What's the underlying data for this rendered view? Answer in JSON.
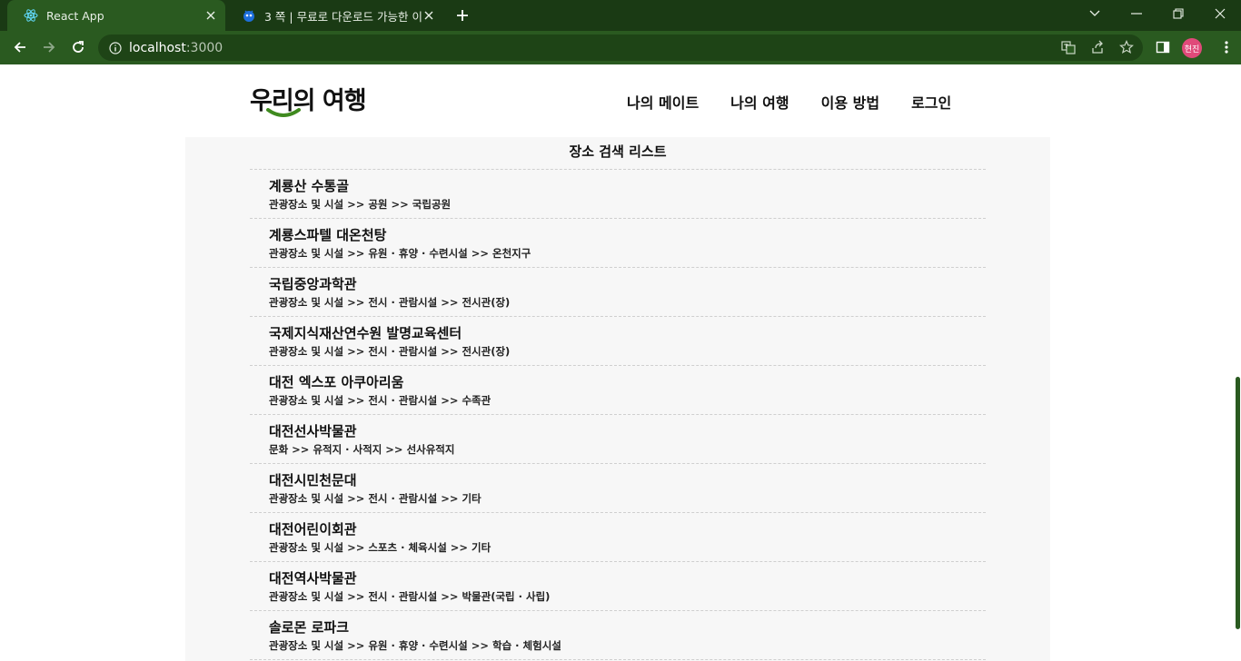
{
  "browser": {
    "tabs": [
      {
        "title": "React App",
        "icon": "react-icon",
        "active": true
      },
      {
        "title": "3 쪽 | 무료로 다운로드 가능한 이",
        "icon": "freepik-icon",
        "active": false
      }
    ],
    "url": {
      "host": "localhost",
      "port": ":3000"
    },
    "profile_initials": "현진",
    "accent": "#2a5a20"
  },
  "site": {
    "logo_text": "우리의 여행",
    "nav": [
      "나의 메이트",
      "나의 여행",
      "이용 방법",
      "로그인"
    ]
  },
  "search_list": {
    "title": "장소 검색 리스트",
    "items": [
      {
        "name": "계룡산 수통골",
        "category": "관광장소 및 시설 >> 공원 >> 국립공원"
      },
      {
        "name": "계룡스파텔 대온천탕",
        "category": "관광장소 및 시설 >> 유원 · 휴양 · 수련시설 >> 온천지구"
      },
      {
        "name": "국립중앙과학관",
        "category": "관광장소 및 시설 >> 전시 · 관람시설 >> 전시관(장)"
      },
      {
        "name": "국제지식재산연수원 발명교육센터",
        "category": "관광장소 및 시설 >> 전시 · 관람시설 >> 전시관(장)"
      },
      {
        "name": "대전 엑스포 아쿠아리움",
        "category": "관광장소 및 시설 >> 전시 · 관람시설 >> 수족관"
      },
      {
        "name": "대전선사박물관",
        "category": "문화 >> 유적지 · 사적지 >> 선사유적지"
      },
      {
        "name": "대전시민천문대",
        "category": "관광장소 및 시설 >> 전시 · 관람시설 >> 기타"
      },
      {
        "name": "대전어린이회관",
        "category": "관광장소 및 시설 >> 스포츠 · 체육시설 >> 기타"
      },
      {
        "name": "대전역사박물관",
        "category": "관광장소 및 시설 >> 전시 · 관람시설 >> 박물관(국립 · 사립)"
      },
      {
        "name": "솔로몬 로파크",
        "category": "관광장소 및 시설 >> 유원 · 휴양 · 수련시설 >> 학습 · 체험시설"
      }
    ]
  }
}
